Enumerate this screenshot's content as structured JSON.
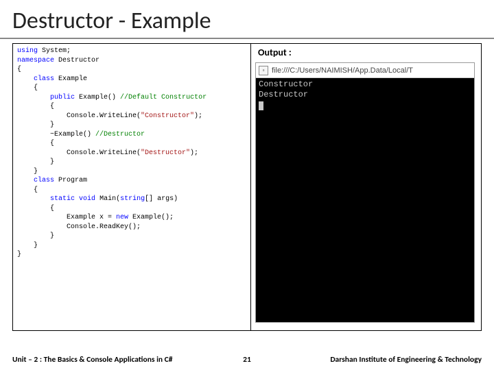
{
  "title": "Destructor - Example",
  "code": {
    "l1_kw1": "using",
    "l1_rest": " System;",
    "l2_kw1": "namespace",
    "l2_rest": " Destructor",
    "l3": "{",
    "l4_p": "    ",
    "l4_kw": "class",
    "l4_rest": " Example",
    "l5": "    {",
    "l6_p": "        ",
    "l6_kw": "public",
    "l6_mid": " Example() ",
    "l6_cm": "//Default Constructor",
    "l7": "        {",
    "l8_p": "            Console.WriteLine(",
    "l8_str": "\"Constructor\"",
    "l8_end": ");",
    "l9": "        }",
    "l10_p": "        ~Example() ",
    "l10_cm": "//Destructor",
    "l11": "        {",
    "l12_p": "            Console.WriteLine(",
    "l12_str": "\"Destructor\"",
    "l12_end": ");",
    "l13": "        }",
    "l14": "    }",
    "l15_p": "    ",
    "l15_kw": "class",
    "l15_rest": " Program",
    "l16": "    {",
    "l17_p": "        ",
    "l17_kw1": "static",
    "l17_sp": " ",
    "l17_kw2": "void",
    "l17_mid": " Main(",
    "l17_kw3": "string",
    "l17_rest": "[] args)",
    "l18": "        {",
    "l19_p": "            Example x = ",
    "l19_kw": "new",
    "l19_rest": " Example();",
    "l20": "            Console.ReadKey();",
    "l21": "        }",
    "l22": "    }",
    "l23": "}"
  },
  "output": {
    "label": "Output :",
    "url": "file:///C:/Users/NAIMISH/App.Data/Local/T",
    "line1": "Constructor",
    "line2": "Destructor"
  },
  "footer": {
    "left": "Unit – 2 : The Basics & Console Applications in C#",
    "page": "21",
    "right": "Darshan Institute of Engineering & Technology"
  }
}
